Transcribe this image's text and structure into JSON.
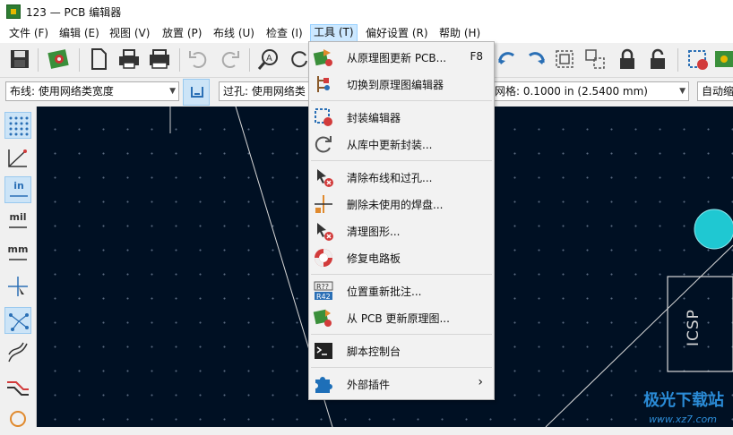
{
  "window": {
    "title": "123 — PCB 编辑器"
  },
  "menubar": [
    {
      "label": "文件 (F)"
    },
    {
      "label": "编辑 (E)"
    },
    {
      "label": "视图 (V)"
    },
    {
      "label": "放置 (P)"
    },
    {
      "label": "布线 (U)"
    },
    {
      "label": "检查 (I)"
    },
    {
      "label": "工具 (T)"
    },
    {
      "label": "偏好设置 (R)"
    },
    {
      "label": "帮助 (H)"
    }
  ],
  "toolbar2": {
    "track_width": "布线: 使用网络类宽度",
    "via_size": "过孔: 使用网络类",
    "grid": "网格: 0.1000 in (2.5400 mm)",
    "zoom": "自动缩"
  },
  "left_toolbar": {
    "in_label": "in",
    "mil_label": "mil",
    "mm_label": "mm"
  },
  "tools_menu": {
    "items": [
      {
        "label": "从原理图更新 PCB...",
        "shortcut": "F8",
        "icon": "update-pcb-icon"
      },
      {
        "label": "切换到原理图编辑器",
        "shortcut": "",
        "icon": "schematic-editor-icon"
      },
      {
        "label": "封装编辑器",
        "shortcut": "",
        "icon": "footprint-editor-icon"
      },
      {
        "label": "从库中更新封装...",
        "shortcut": "",
        "icon": "refresh-icon"
      },
      {
        "label": "清除布线和过孔...",
        "shortcut": "",
        "icon": "cleanup-tracks-icon"
      },
      {
        "label": "删除未使用的焊盘...",
        "shortcut": "",
        "icon": "remove-pads-icon"
      },
      {
        "label": "清理图形...",
        "shortcut": "",
        "icon": "cleanup-graphics-icon"
      },
      {
        "label": "修复电路板",
        "shortcut": "",
        "icon": "repair-board-icon"
      },
      {
        "label": "位置重新批注...",
        "shortcut": "",
        "icon": "reannotate-icon"
      },
      {
        "label": "从 PCB 更新原理图...",
        "shortcut": "",
        "icon": "update-schematic-icon"
      },
      {
        "label": "脚本控制台",
        "shortcut": "",
        "icon": "console-icon"
      },
      {
        "label": "外部插件",
        "shortcut": "",
        "icon": "puzzle-icon",
        "submenu_arrow": "›"
      }
    ]
  },
  "canvas": {
    "silkscreen_text": "ICSP",
    "pad_color": "#1fc8d2",
    "background": "#001023"
  },
  "watermark": {
    "text": "极光下载站",
    "url": "www.xz7.com"
  },
  "colors": {
    "menu_highlight": "#cce8ff",
    "toolbar_active": "#cce4f7",
    "accent_red": "#d23b3b"
  }
}
